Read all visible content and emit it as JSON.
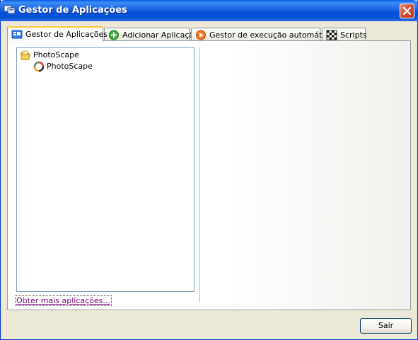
{
  "window": {
    "title": "Gestor de Aplicações"
  },
  "tabs": [
    {
      "label": "Gestor de Aplicações",
      "icon": "app-manager-icon",
      "active": true
    },
    {
      "label": "Adicionar Aplicação",
      "icon": "add-plus-icon",
      "active": false
    },
    {
      "label": "Gestor de execução automática",
      "icon": "play-icon",
      "active": false
    },
    {
      "label": "Scripts",
      "icon": "checkered-flag-icon",
      "active": false
    }
  ],
  "tree": {
    "items": [
      {
        "label": "PhotoScape",
        "icon": "folder-icon",
        "level": 0
      },
      {
        "label": "PhotoScape",
        "icon": "photoscape-app-icon",
        "level": 1
      }
    ]
  },
  "links": {
    "more_apps": "Obter mais aplicações..."
  },
  "buttons": {
    "exit": "Sair"
  },
  "colors": {
    "titlebar": "#0A5FE8",
    "active_tab_accent": "#FFC83C",
    "link_visited": "#800080",
    "close_button": "#D3452B"
  }
}
